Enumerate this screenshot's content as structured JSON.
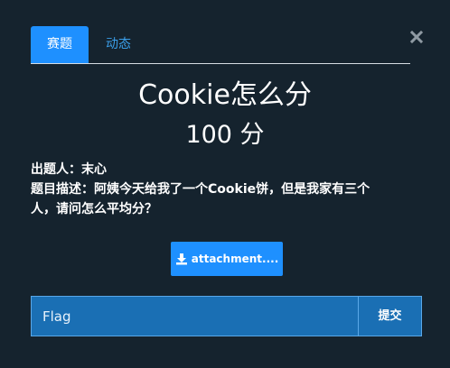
{
  "tabs": [
    {
      "label": "赛题",
      "active": true
    },
    {
      "label": "动态",
      "active": false
    }
  ],
  "close_icon": "close-icon",
  "challenge": {
    "title": "Cookie怎么分",
    "points": "100 分",
    "author": "出题人：末心",
    "description_line1": "题目描述：阿姨今天给我了一个Cookie饼，但是我家有三个",
    "description_line2": "人，请问怎么平均分？"
  },
  "attachment": {
    "label": "attachment....",
    "icon": "download-icon"
  },
  "flag_form": {
    "placeholder": "Flag",
    "value": "",
    "submit_label": "提交"
  },
  "colors": {
    "background": "#15232e",
    "accent": "#1e90ff",
    "input_bg": "#1a6fb4",
    "inactive_tab": "#3a9ee8"
  }
}
